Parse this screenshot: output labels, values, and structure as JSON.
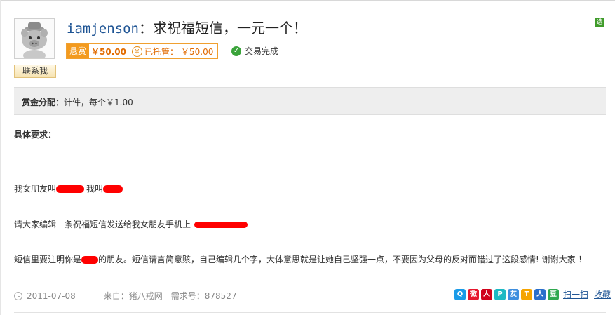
{
  "header": {
    "username": "iamjenson",
    "title_text": "：求祝福短信，一元一个！",
    "badge": "选"
  },
  "contact_label": "联系我",
  "reward": {
    "tag": "悬赏",
    "amount": "￥50.00",
    "coin_symbol": "¥",
    "escrow_label": "已托管：",
    "escrow_amount": "￥50.00"
  },
  "status": {
    "label": "交易完成"
  },
  "allocation": {
    "label": "赏金分配：",
    "value": "计件，每个￥1.00"
  },
  "requirements": {
    "heading": "具体要求：",
    "p1_a": "我女朋友叫",
    "p1_b": "我叫",
    "p2": "请大家编辑一条祝福短信发送给我女朋友手机上",
    "p3_a": "短信里要注明你是",
    "p3_b": "的朋友。短信请言简意赅，自己编辑几个字，大体意思就是让她自己坚强一点，不要因为父母的反对而错过了这段感情!    谢谢大家  ！"
  },
  "footer": {
    "date": "2011-07-08",
    "source_label": "来自：猪八戒网",
    "req_no_label": "需求号：878527",
    "scan_label": "扫一扫",
    "fav_label": "收藏"
  },
  "share_icons": [
    "qq-icon",
    "weibo-icon",
    "renren-icon",
    "qzone-icon",
    "pengyou-icon",
    "tianya-icon",
    "renren-people-icon",
    "douban-icon"
  ],
  "colors": {
    "accent_orange": "#f39a1e",
    "link_blue": "#1e5494",
    "redaction": "#ff0000",
    "success_green": "#3aa33a"
  }
}
